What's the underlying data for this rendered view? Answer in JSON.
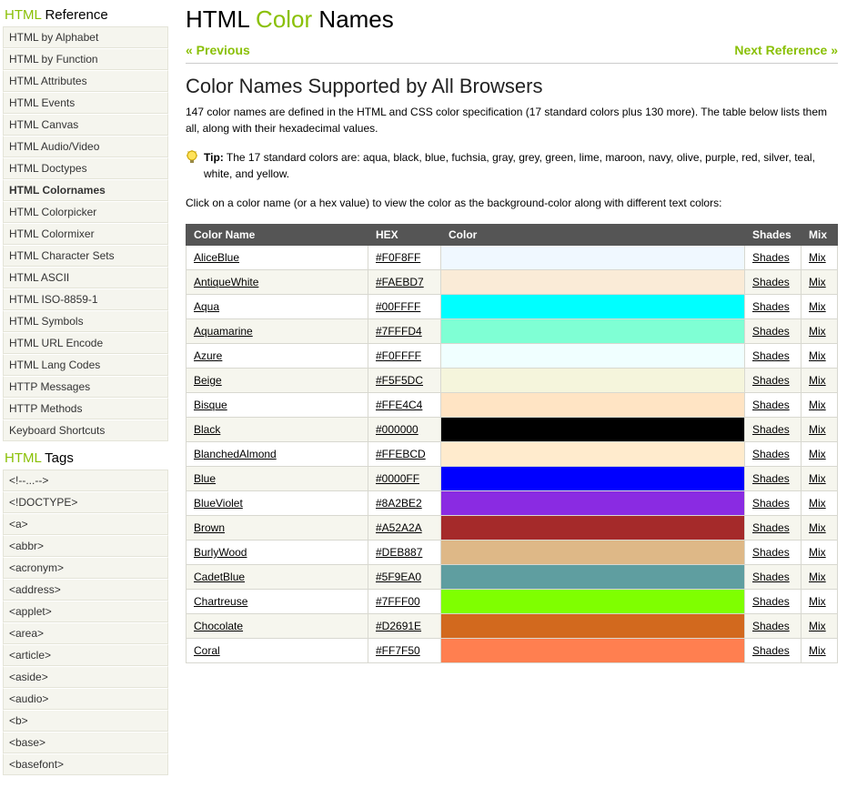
{
  "sidebar": {
    "ref_heading_prefix": "HTML",
    "ref_heading_suffix": " Reference",
    "tags_heading_prefix": "HTML",
    "tags_heading_suffix": " Tags",
    "ref_items": [
      "HTML by Alphabet",
      "HTML by Function",
      "HTML Attributes",
      "HTML Events",
      "HTML Canvas",
      "HTML Audio/Video",
      "HTML Doctypes",
      "HTML Colornames",
      "HTML Colorpicker",
      "HTML Colormixer",
      "HTML Character Sets",
      "HTML ASCII",
      "HTML ISO-8859-1",
      "HTML Symbols",
      "HTML URL Encode",
      "HTML Lang Codes",
      "HTTP Messages",
      "HTTP Methods",
      "Keyboard Shortcuts"
    ],
    "ref_active_index": 7,
    "tag_items": [
      "<!--...-->",
      "<!DOCTYPE>",
      "<a>",
      "<abbr>",
      "<acronym>",
      "<address>",
      "<applet>",
      "<area>",
      "<article>",
      "<aside>",
      "<audio>",
      "<b>",
      "<base>",
      "<basefont>"
    ]
  },
  "header": {
    "title_pre": "HTML ",
    "title_hl": "Color",
    "title_post": " Names",
    "prev": "« Previous",
    "next": "Next Reference »"
  },
  "section": {
    "h2": "Color Names Supported by All Browsers",
    "intro": "147 color names are defined in the HTML and CSS color specification (17 standard colors plus 130 more). The table below lists them all, along with their hexadecimal values.",
    "tip_label": "Tip:",
    "tip_text": " The 17 standard colors are: aqua, black, blue, fuchsia, gray, grey, green, lime, maroon, navy, olive, purple, red, silver, teal, white, and yellow.",
    "click_text": "Click on a color name (or a hex value) to view the color as the background-color along with different text colors:"
  },
  "table": {
    "headers": {
      "name": "Color Name",
      "hex": "HEX",
      "color": "Color",
      "shades": "Shades",
      "mix": "Mix"
    },
    "shades_label": "Shades",
    "mix_label": "Mix",
    "rows": [
      {
        "name": "AliceBlue",
        "hex": "#F0F8FF"
      },
      {
        "name": "AntiqueWhite",
        "hex": "#FAEBD7"
      },
      {
        "name": "Aqua",
        "hex": "#00FFFF"
      },
      {
        "name": "Aquamarine",
        "hex": "#7FFFD4"
      },
      {
        "name": "Azure",
        "hex": "#F0FFFF"
      },
      {
        "name": "Beige",
        "hex": "#F5F5DC"
      },
      {
        "name": "Bisque",
        "hex": "#FFE4C4"
      },
      {
        "name": "Black",
        "hex": "#000000"
      },
      {
        "name": "BlanchedAlmond",
        "hex": "#FFEBCD"
      },
      {
        "name": "Blue",
        "hex": "#0000FF"
      },
      {
        "name": "BlueViolet",
        "hex": "#8A2BE2"
      },
      {
        "name": "Brown",
        "hex": "#A52A2A"
      },
      {
        "name": "BurlyWood",
        "hex": "#DEB887"
      },
      {
        "name": "CadetBlue",
        "hex": "#5F9EA0"
      },
      {
        "name": "Chartreuse",
        "hex": "#7FFF00"
      },
      {
        "name": "Chocolate",
        "hex": "#D2691E"
      },
      {
        "name": "Coral",
        "hex": "#FF7F50"
      }
    ]
  }
}
